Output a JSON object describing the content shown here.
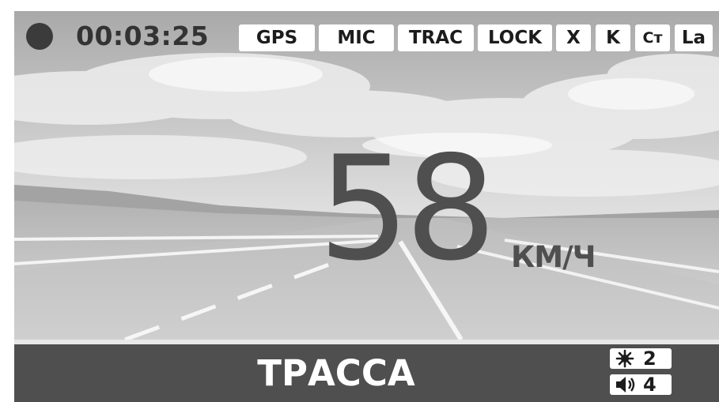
{
  "recording": {
    "indicator_icon": "record-dot-icon",
    "elapsed": "00:03:25"
  },
  "status_badges": [
    "GPS",
    "MIC",
    "TRAC",
    "LOCK",
    "X",
    "K",
    "Ст",
    "La"
  ],
  "speed": {
    "value": "58",
    "unit": "КМ/Ч"
  },
  "mode": {
    "label": "ТРАССА"
  },
  "indicators": {
    "brightness": {
      "icon": "brightness-icon",
      "value": "2"
    },
    "volume": {
      "icon": "speaker-icon",
      "value": "4"
    }
  },
  "colors": {
    "accent_dark": "#4f4f4f",
    "badge_background": "#ffffff",
    "label_text": "#ffffff"
  }
}
